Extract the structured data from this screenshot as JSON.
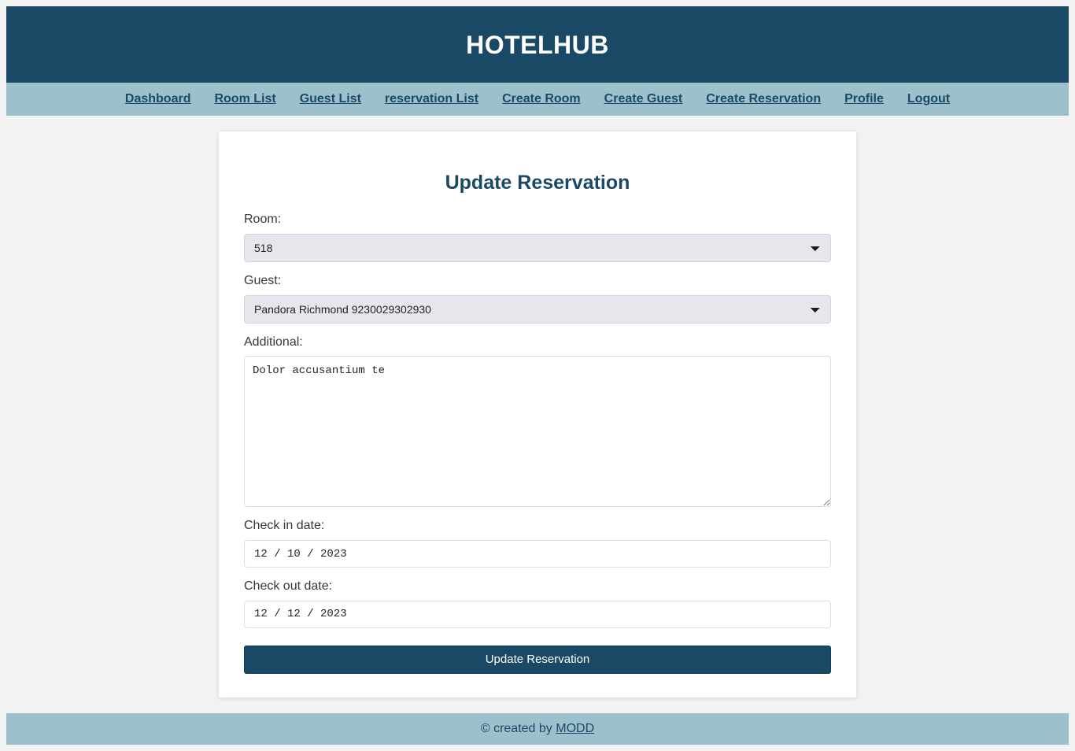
{
  "header": {
    "title": "HOTELHUB",
    "background_color": "#1a4965",
    "text_color": "#ffffff"
  },
  "nav": {
    "background_color": "#9dc1cc",
    "link_color": "#1a4965",
    "items": [
      {
        "label": "Dashboard"
      },
      {
        "label": "Room List"
      },
      {
        "label": "Guest List"
      },
      {
        "label": "reservation List"
      },
      {
        "label": "Create Room"
      },
      {
        "label": "Create Guest"
      },
      {
        "label": "Create Reservation"
      },
      {
        "label": "Profile"
      },
      {
        "label": "Logout"
      }
    ]
  },
  "form": {
    "title": "Update Reservation",
    "title_color": "#1a4965",
    "room": {
      "label": "Room:",
      "value": "518",
      "icon": "chevron-down-icon"
    },
    "guest": {
      "label": "Guest:",
      "value": "Pandora Richmond 9230029302930",
      "icon": "chevron-down-icon"
    },
    "additional": {
      "label": "Additional:",
      "value": "Dolor accusantium te",
      "placeholder": ""
    },
    "check_in": {
      "label": "Check in date:",
      "value": "12 / 10 / 2023"
    },
    "check_out": {
      "label": "Check out date:",
      "value": "12 / 12 / 2023"
    },
    "submit": {
      "label": "Update Reservation",
      "background_color": "#1a4965"
    }
  },
  "footer": {
    "text": "© created by",
    "link": "MODD",
    "background_color": "#9dc1cc"
  }
}
